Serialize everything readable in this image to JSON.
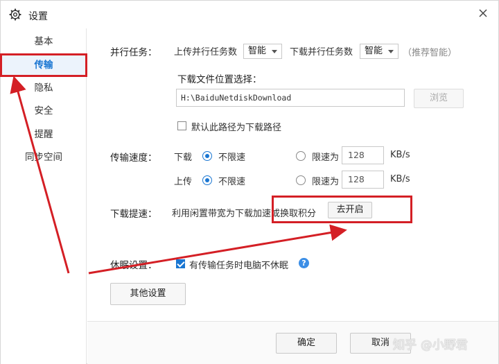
{
  "window": {
    "title": "设置",
    "close_symbol": "×"
  },
  "sidebar": {
    "items": [
      {
        "label": "基本",
        "active": false
      },
      {
        "label": "传输",
        "active": true
      },
      {
        "label": "隐私",
        "active": false
      },
      {
        "label": "安全",
        "active": false
      },
      {
        "label": "提醒",
        "active": false
      },
      {
        "label": "同步空间",
        "active": false
      }
    ]
  },
  "parallel": {
    "label": "并行任务：",
    "upload_label": "上传并行任务数",
    "upload_value": "智能",
    "download_label": "下载并行任务数",
    "download_value": "智能",
    "hint": "（推荐智能）"
  },
  "download_location": {
    "label": "下载文件位置选择：",
    "path": "H:\\BaiduNetdiskDownload",
    "browse": "浏览",
    "default_checkbox_label": "默认此路径为下载路径",
    "default_checked": false
  },
  "speed": {
    "label": "传输速度：",
    "download": {
      "label": "下载",
      "unlimited": "不限速",
      "limit_label": "限速为",
      "limit_value": "128",
      "unit": "KB/s"
    },
    "upload": {
      "label": "上传",
      "unlimited": "不限速",
      "limit_label": "限速为",
      "limit_value": "128",
      "unit": "KB/s"
    }
  },
  "boost": {
    "label": "下载提速：",
    "desc": "利用闲置带宽为下载加速或换取积分",
    "button": "去开启"
  },
  "sleep": {
    "label": "休眠设置：",
    "checkbox_label": "有传输任务时电脑不休眠",
    "checked": true,
    "help": "?"
  },
  "other_settings": "其他设置",
  "footer": {
    "ok": "确定",
    "cancel": "取消"
  },
  "watermark": "知乎 @小野君",
  "colors": {
    "accent": "#1a76d2",
    "annotation": "#d41f25"
  }
}
